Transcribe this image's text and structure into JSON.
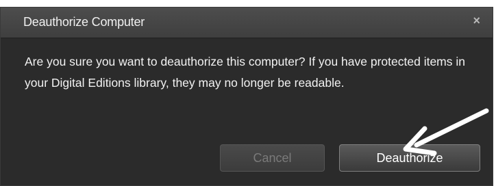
{
  "dialog": {
    "title": "Deauthorize Computer",
    "close_glyph": "×",
    "message": "Are you sure you want to deauthorize this computer?  If you have protected items in your Digital Editions library, they may no longer be readable.",
    "buttons": {
      "cancel_label": "Cancel",
      "cancel_enabled": false,
      "deauthorize_label": "Deauthorize"
    }
  },
  "annotation": {
    "icon": "arrow-pointing-at-deauthorize",
    "color": "#ffffff"
  }
}
